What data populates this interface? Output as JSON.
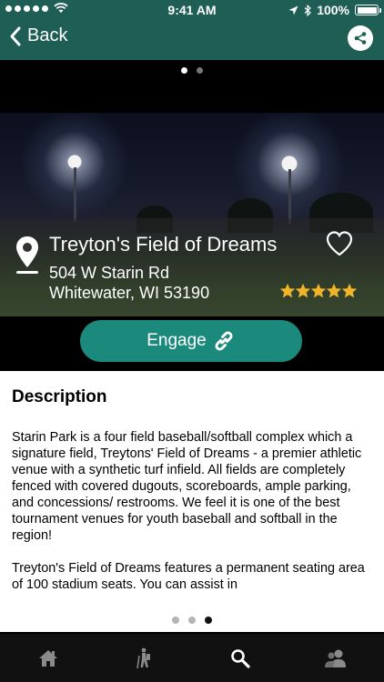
{
  "status_bar": {
    "time": "9:41 AM",
    "battery": "100%"
  },
  "nav": {
    "back_label": "Back",
    "share_icon": "share-icon"
  },
  "carousel": {
    "total": 2,
    "active_index": 0
  },
  "venue": {
    "name": "Treyton's Field of Dreams",
    "address_line1": "504 W Starin Rd",
    "address_line2": "Whitewater, WI 53190",
    "rating": 5,
    "rating_max": 5,
    "star_color": "#f0b429"
  },
  "engage": {
    "label": "Engage",
    "icon": "link-icon"
  },
  "description": {
    "heading": "Description",
    "paragraph1": "Starin Park is a four field baseball/softball complex which a signature field, Treytons' Field of Dreams - a premier athletic venue with a synthetic turf infield.  All fields are completely fenced with covered dugouts, scoreboards, ample parking, and concessions/ restrooms.  We feel it is one of the best tournament venues for youth baseball and softball in the region!",
    "paragraph2": "Treyton's Field of Dreams features a permanent seating area of 100 stadium seats. You can assist in"
  },
  "pager": {
    "total": 3,
    "active_index": 2
  },
  "tabs": [
    {
      "icon": "home-icon"
    },
    {
      "icon": "hiker-icon"
    },
    {
      "icon": "search-icon"
    },
    {
      "icon": "people-icon"
    }
  ],
  "colors": {
    "nav_bg": "#1f5e55",
    "accent": "#1b8a7c"
  }
}
